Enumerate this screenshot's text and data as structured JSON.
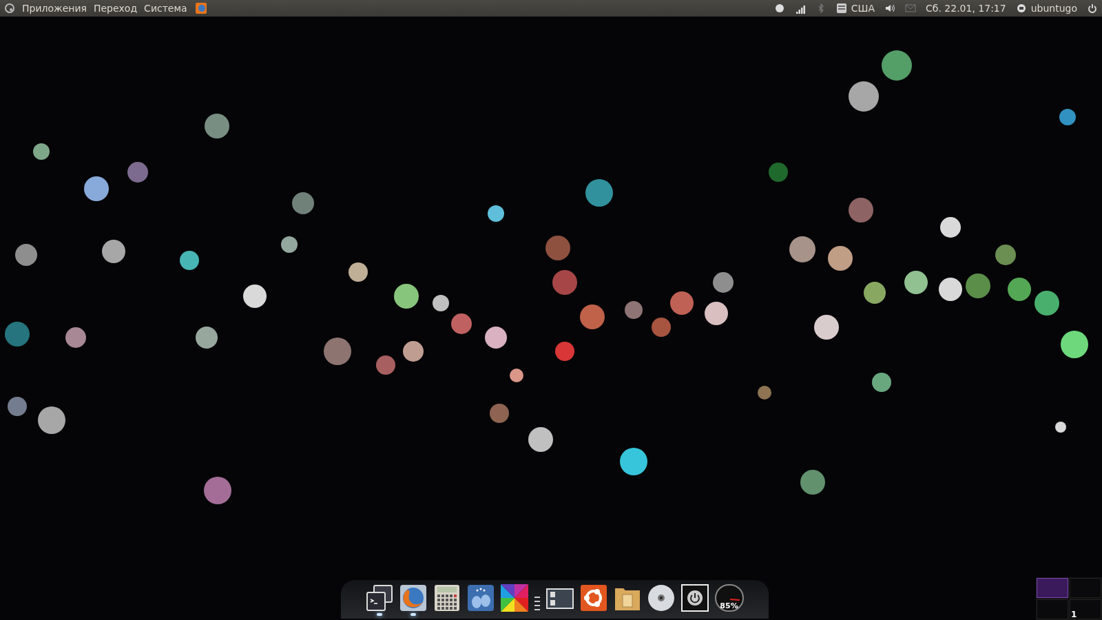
{
  "top_panel": {
    "menus": [
      {
        "label": "Приложения"
      },
      {
        "label": "Переход"
      },
      {
        "label": "Система"
      }
    ],
    "keyboard_layout": "США",
    "clock": "Сб. 22.01, 17:17",
    "user": "ubuntugo"
  },
  "dock": {
    "items": [
      {
        "kind": "terminal",
        "running": true
      },
      {
        "kind": "browser",
        "running": true
      },
      {
        "kind": "calculator",
        "running": false
      },
      {
        "kind": "chat",
        "running": false
      },
      {
        "kind": "colors",
        "running": false
      },
      {
        "kind": "separator",
        "running": false
      },
      {
        "kind": "windows",
        "running": false
      },
      {
        "kind": "ubuntu",
        "running": false
      },
      {
        "kind": "folder",
        "running": false
      },
      {
        "kind": "disc",
        "running": false
      },
      {
        "kind": "power",
        "running": false
      },
      {
        "kind": "gauge",
        "running": false,
        "level": 0.85,
        "reading": "85%"
      }
    ]
  },
  "workspaces": {
    "items": [
      {
        "selected": true
      },
      {
        "selected": false
      },
      {
        "selected": false
      },
      {
        "selected": false
      }
    ],
    "current_number": "1"
  }
}
